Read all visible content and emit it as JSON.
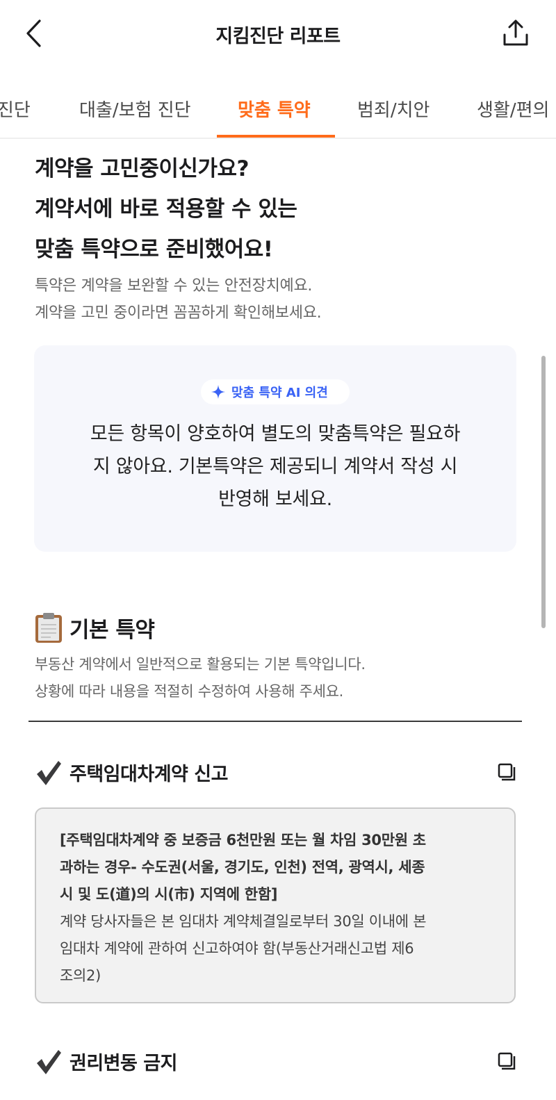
{
  "header": {
    "title": "지킴진단 리포트",
    "back_icon": "chevron-left-icon",
    "share_icon": "share-icon"
  },
  "tabs": [
    {
      "label": "진단",
      "active": false
    },
    {
      "label": "대출/보험 진단",
      "active": false
    },
    {
      "label": "맞춤 특약",
      "active": true
    },
    {
      "label": "범죄/치안",
      "active": false
    },
    {
      "label": "생활/편의",
      "active": false
    }
  ],
  "intro": {
    "headline_lines": [
      "계약을 고민중이신가요?",
      "계약서에 바로 적용할 수 있는",
      "맞춤 특약으로 준비했어요!"
    ],
    "subtext_lines": [
      "특약은 계약을 보완할 수 있는 안전장치예요.",
      "계약을 고민 중이라면 꼼꼼하게 확인해보세요."
    ]
  },
  "ai_opinion": {
    "badge": "맞춤 특약 AI 의견",
    "badge_icon": "sparkle-icon",
    "message_lines": [
      "모든 항목이 양호하여 별도의 맞춤특약은 필요하",
      "지 않아요. 기본특약은 제공되니 계약서 작성 시",
      "반영해 보세요."
    ]
  },
  "basic_section": {
    "icon": "clipboard-icon",
    "title": "기본 특약",
    "desc_lines": [
      "부동산 계약에서 일반적으로 활용되는 기본 특약입니다.",
      "상황에 따라 내용을 적절히 수정하여 사용해 주세요."
    ]
  },
  "clauses": [
    {
      "title": "주택임대차계약 신고",
      "bold_lines": [
        "[주택임대차계약 중 보증금 6천만원 또는 월 차임 30만원 초",
        "과하는 경우- 수도권(서울, 경기도, 인천) 전역, 광역시, 세종",
        "시 및 도(道)의 시(市) 지역에 한함]"
      ],
      "body_lines": [
        "계약 당사자들은 본 임대차 계약체결일로부터 30일 이내에 본",
        "임대차 계약에 관하여 신고하여야 함(부동산거래신고법 제6",
        "조의2)"
      ]
    },
    {
      "title": "권리변동 금지"
    }
  ],
  "colors": {
    "accent": "#ff6b1a",
    "ai_blue": "#3a63f5",
    "card_bg": "#f6f7fc",
    "clause_bg": "#f2f2f2"
  }
}
